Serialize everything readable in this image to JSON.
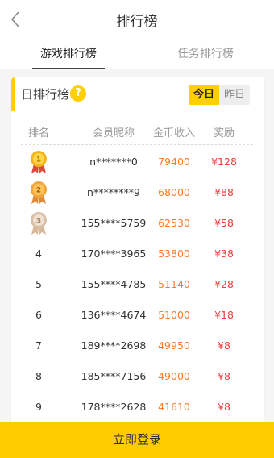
{
  "header": {
    "title": "排行榜"
  },
  "tabs": [
    {
      "label": "游戏排行榜",
      "active": true
    },
    {
      "label": "任务排行榜",
      "active": false
    }
  ],
  "ranking": {
    "title": "日排行榜",
    "periods": [
      {
        "label": "今日",
        "active": true
      },
      {
        "label": "昨日",
        "active": false
      }
    ],
    "columns": [
      "排名",
      "会员昵称",
      "金币收入",
      "奖励"
    ],
    "rows": [
      {
        "rank": "1",
        "medal": "gold-medal-icon",
        "name": "n*******0",
        "coins": "79400",
        "prize": "¥128"
      },
      {
        "rank": "2",
        "medal": "silver-medal-icon",
        "name": "n********9",
        "coins": "68000",
        "prize": "¥88"
      },
      {
        "rank": "3",
        "medal": "bronze-medal-icon",
        "name": "155****5759",
        "coins": "62530",
        "prize": "¥58"
      },
      {
        "rank": "4",
        "name": "170****3965",
        "coins": "53800",
        "prize": "¥38"
      },
      {
        "rank": "5",
        "name": "155****4785",
        "coins": "51140",
        "prize": "¥28"
      },
      {
        "rank": "6",
        "name": "136****4674",
        "coins": "51000",
        "prize": "¥18"
      },
      {
        "rank": "7",
        "name": "189****2698",
        "coins": "49950",
        "prize": "¥8"
      },
      {
        "rank": "8",
        "name": "185****7156",
        "coins": "49000",
        "prize": "¥8"
      },
      {
        "rank": "9",
        "name": "178****2628",
        "coins": "41610",
        "prize": "¥8"
      }
    ]
  },
  "login_button": "立即登录",
  "colors": {
    "accent": "#ffcc00",
    "coins": "#ff7a2a",
    "prize": "#ee3b3b"
  },
  "icons": {
    "back": "chevron-left-icon",
    "help": "question-icon"
  }
}
